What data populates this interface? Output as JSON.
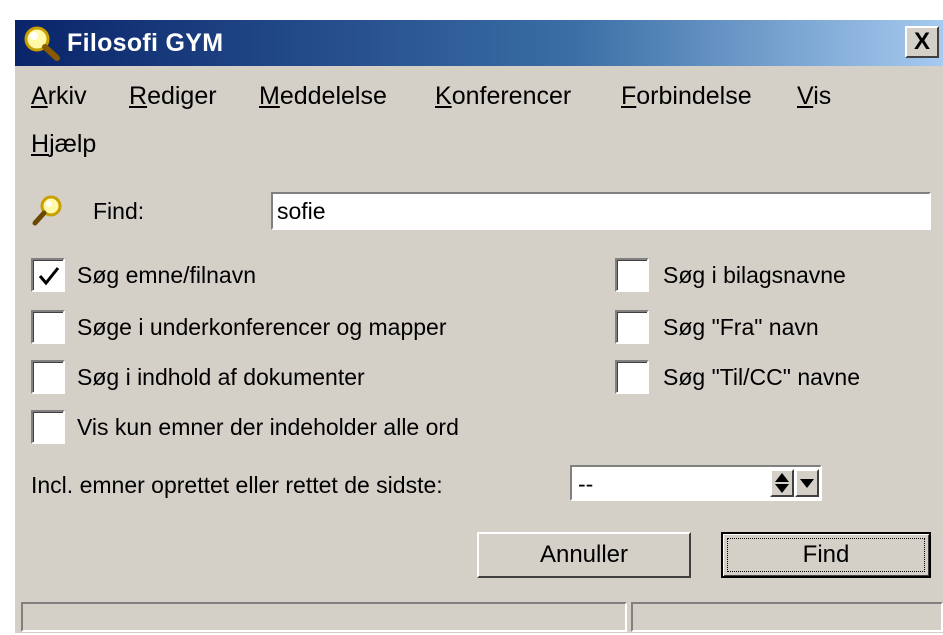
{
  "window": {
    "title": "Filosofi GYM",
    "close_label": "X"
  },
  "menu": {
    "items": [
      {
        "mnemonic": "A",
        "rest": "rkiv"
      },
      {
        "mnemonic": "R",
        "rest": "ediger"
      },
      {
        "mnemonic": "M",
        "rest": "eddelelse"
      },
      {
        "mnemonic": "K",
        "rest": "onferencer"
      },
      {
        "mnemonic": "F",
        "rest": "orbindelse"
      },
      {
        "mnemonic": "V",
        "rest": "is"
      },
      {
        "mnemonic": "H",
        "rest": "jælp"
      }
    ]
  },
  "search": {
    "label": "Find:",
    "value": "sofie"
  },
  "options_left": [
    {
      "label": "Søg emne/filnavn",
      "checked": true
    },
    {
      "label": "Søge i underkonferencer og mapper",
      "checked": false
    },
    {
      "label": "Søg i indhold af dokumenter",
      "checked": false
    },
    {
      "label": "Vis kun emner der indeholder alle ord",
      "checked": false
    }
  ],
  "options_right": [
    {
      "label": "Søg i bilagsnavne",
      "checked": false
    },
    {
      "label": "Søg \"Fra\" navn",
      "checked": false
    },
    {
      "label": "Søg \"Til/CC\" navne",
      "checked": false
    }
  ],
  "period": {
    "label": "Incl. emner oprettet eller rettet de sidste:",
    "value": "--"
  },
  "buttons": {
    "cancel": "Annuller",
    "find": "Find"
  },
  "status": {
    "pane1": "",
    "pane2": ""
  },
  "colors": {
    "titlebar_start": "#0a246a",
    "titlebar_end": "#a6caf0",
    "face": "#d4d0c8"
  },
  "icons": {
    "title": "magnifier-icon",
    "find": "magnifier-icon",
    "close": "close-icon"
  }
}
